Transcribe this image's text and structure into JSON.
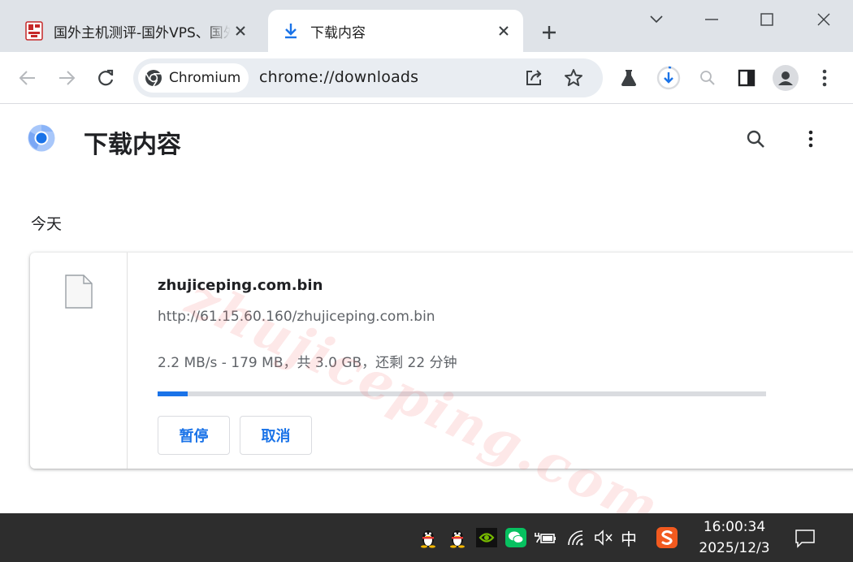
{
  "tabs": [
    {
      "title": "国外主机测评-国外VPS、国外服务器",
      "active": false
    },
    {
      "title": "下载内容",
      "active": true
    }
  ],
  "omnibox": {
    "chip_label": "Chromium",
    "url": "chrome://downloads"
  },
  "page": {
    "title": "下载内容",
    "section_date": "今天"
  },
  "download": {
    "file_name": "zhujiceping.com.bin",
    "source_url": "http://61.15.60.160/zhujiceping.com.bin",
    "status": "2.2 MB/s - 179 MB，共 3.0 GB，还剩 22 分钟",
    "progress_fraction": 0.05,
    "pause_label": "暂停",
    "cancel_label": "取消"
  },
  "watermark": "zhujiceping.com",
  "taskbar": {
    "ime_label": "中",
    "time": "16:00:34",
    "date": "2025/12/3"
  },
  "colors": {
    "accent": "#1a73e8",
    "tabstrip": "#dfe3e8",
    "taskbar": "#2d2d2d"
  }
}
